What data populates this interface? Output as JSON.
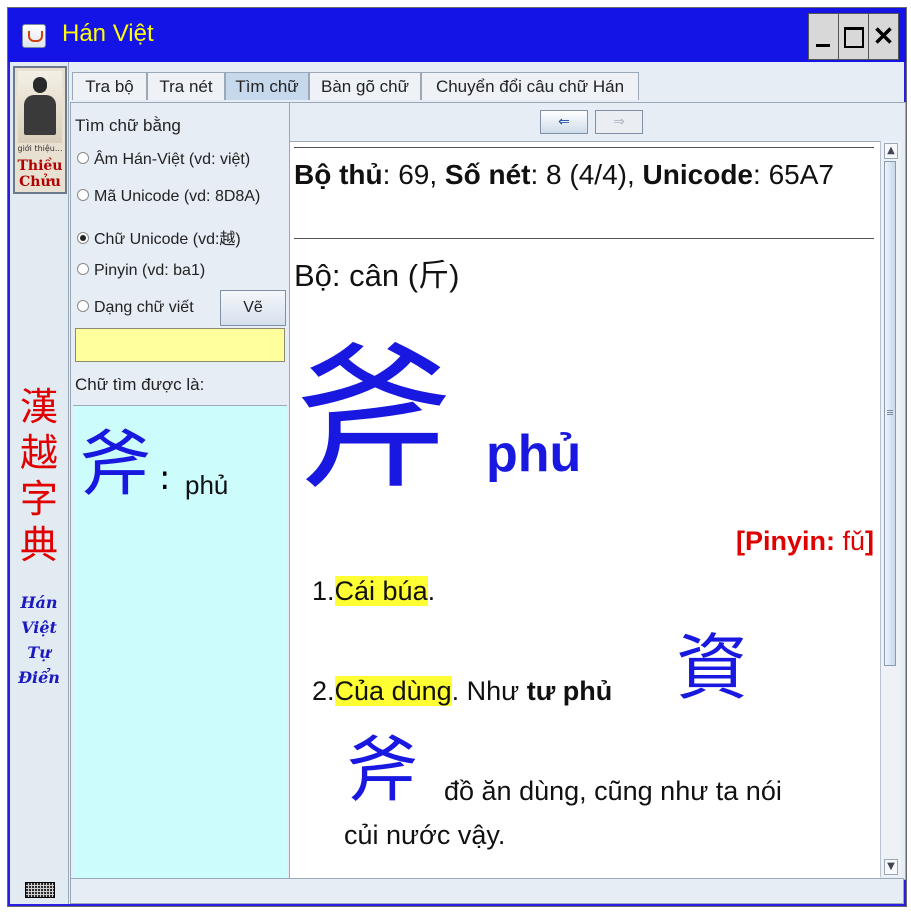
{
  "window": {
    "title": "Hán Việt"
  },
  "sidebar": {
    "portrait_caption": "giới thiệu...",
    "portrait_name_line1": "Thiều",
    "portrait_name_line2": "Chửu",
    "han_title": [
      "漢",
      "越",
      "字",
      "典"
    ],
    "viet_title": [
      "Hán",
      "Việt",
      "Tự",
      "Điển"
    ],
    "keyboard_icon": "keyboard-icon"
  },
  "tabs": [
    {
      "label": "Tra bộ",
      "active": false
    },
    {
      "label": "Tra nét",
      "active": false
    },
    {
      "label": "Tìm chữ",
      "active": true
    },
    {
      "label": "Bàn gõ chữ",
      "active": false
    },
    {
      "label": "Chuyển đổi câu chữ Hán",
      "active": false
    }
  ],
  "search": {
    "heading": "Tìm chữ bằng",
    "options": [
      {
        "label": "Âm Hán-Việt (vd: việt)",
        "selected": false
      },
      {
        "label": "Mã Unicode (vd: 8D8A)",
        "selected": false
      },
      {
        "label": "Chữ Unicode (vd:越)",
        "selected": true
      },
      {
        "label": "Pinyin (vd: ba1)",
        "selected": false
      },
      {
        "label": "Dạng chữ viết",
        "selected": false
      }
    ],
    "draw_button": "Vẽ",
    "input_value": "",
    "found_label": "Chữ tìm được là:",
    "result_char": "斧",
    "result_colon": ":",
    "result_reading": "phủ"
  },
  "nav": {
    "back": "⇐",
    "forward": "⇒"
  },
  "entry": {
    "radical_num_label": "Bộ thủ",
    "radical_num": "69",
    "strokes_label": "Số nét",
    "strokes": "8 (4/4)",
    "unicode_label": "Unicode",
    "unicode": "65A7",
    "radical_prefix": "Bộ: cân (",
    "radical_char": "斤",
    "radical_suffix": ")",
    "char": "斧",
    "reading": "phủ",
    "pinyin_label": "[Pinyin:",
    "pinyin_value": "fǔ",
    "pinyin_close": "]",
    "definitions": {
      "d1_num": "1.",
      "d1_hl": "Cái búa",
      "d1_rest": ".",
      "d2_num": "2.",
      "d2_hl": "Của dùng",
      "d2_text": ". Như ",
      "d2_bold": "tư phủ",
      "d2_char1": "資",
      "d2_char2": "斧",
      "d2_tail1": "đồ ăn dùng, cũng như ta nói",
      "d2_tail2": "củi nước vậy."
    }
  },
  "colors": {
    "title_bar": "#1414e6",
    "title_text": "#ffff00",
    "han_blue": "#1818e0",
    "pinyin_red": "#e00000",
    "highlight": "#ffff33",
    "found_bg": "#ccfcfc",
    "input_bg": "#ffff9e"
  }
}
